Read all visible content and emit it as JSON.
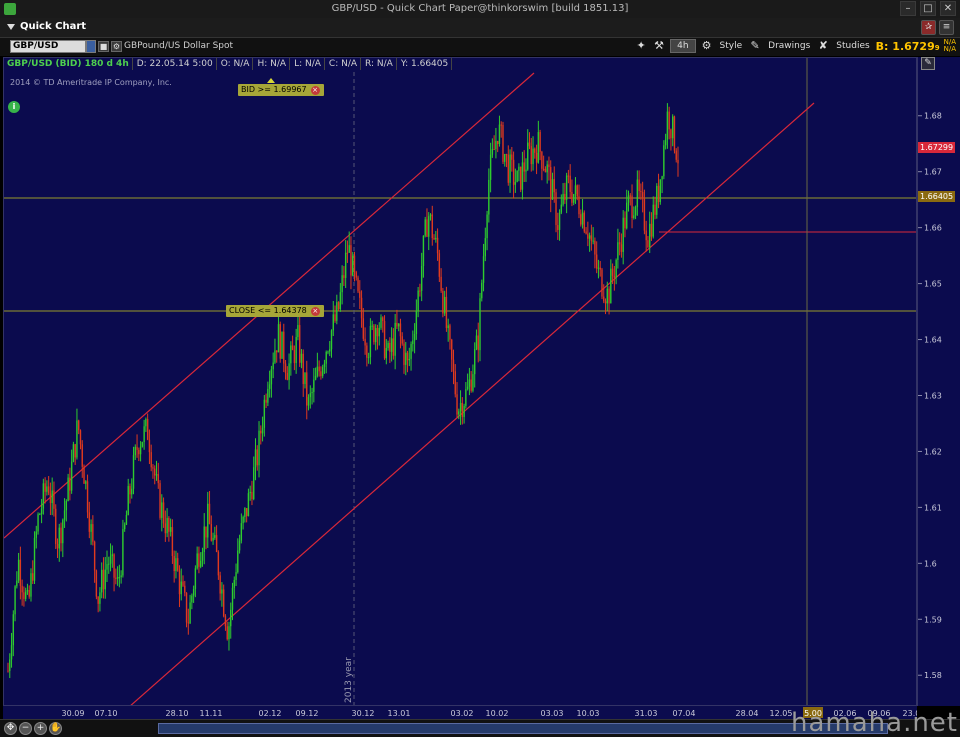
{
  "window": {
    "title": "GBP/USD - Quick Chart Paper@thinkorswim [build 1851.13]"
  },
  "quick_chart": {
    "title": "Quick Chart"
  },
  "toolbar": {
    "symbol": "GBP/USD",
    "symbol_desc": "GBPound/US Dollar Spot",
    "timeframe": "4h",
    "style_label": "Style",
    "drawings_label": "Drawings",
    "studies_label": "Studies",
    "bid_label": "B: 1.6729",
    "bid_suffix": "9",
    "na1": "N/A",
    "na2": "N/A"
  },
  "info": {
    "symbol_line": "GBP/USD (BID) 180 d 4h",
    "date": "D: 22.05.14 5:00",
    "open": "O: N/A",
    "high": "H: N/A",
    "low": "L: N/A",
    "close": "C: N/A",
    "range": "R: N/A",
    "y": "Y: 1.66405",
    "copyright": "2014 © TD Ameritrade IP Company, Inc."
  },
  "alerts": {
    "bid": "BID >= 1.69967",
    "close": "CLOSE <= 1.64378"
  },
  "price_tags": {
    "current": "1.67299",
    "cursor": "1.66405"
  },
  "colors": {
    "background": "#0b0b4e",
    "up": "#2ecc2e",
    "down": "#e03a1e",
    "channel": "#d8283a",
    "hline": "#9a9a2a",
    "current_tag": "#d8283a",
    "cursor_tag": "#8a6a10"
  },
  "chart_data": {
    "type": "candlestick",
    "y_ticks": [
      "1.68",
      "1.67",
      "1.66",
      "1.65",
      "1.64",
      "1.63",
      "1.62",
      "1.61",
      "1.6",
      "1.59",
      "1.58"
    ],
    "x_ticks": [
      "30.09",
      "07.10",
      "28.10",
      "11.11",
      "02.12",
      "09.12",
      "30.12",
      "13.01",
      "03.02",
      "10.02",
      "03.03",
      "10.03",
      "31.03",
      "07.04",
      "28.04",
      "12.05",
      "5.00",
      "02.06",
      "09.06",
      "23.06"
    ],
    "year_label": "2013 year",
    "ylim": [
      1.5745,
      1.6905
    ],
    "close_path": [
      1.581,
      1.601,
      1.592,
      1.608,
      1.615,
      1.604,
      1.613,
      1.625,
      1.611,
      1.594,
      1.601,
      1.596,
      1.611,
      1.622,
      1.624,
      1.612,
      1.606,
      1.598,
      1.59,
      1.602,
      1.608,
      1.6,
      1.588,
      1.603,
      1.611,
      1.62,
      1.634,
      1.641,
      1.635,
      1.64,
      1.628,
      1.634,
      1.64,
      1.645,
      1.657,
      1.647,
      1.639,
      1.644,
      1.637,
      1.642,
      1.635,
      1.648,
      1.663,
      1.655,
      1.64,
      1.628,
      1.631,
      1.64,
      1.668,
      1.678,
      1.671,
      1.668,
      1.673,
      1.675,
      1.67,
      1.661,
      1.668,
      1.665,
      1.66,
      1.652,
      1.648,
      1.656,
      1.664,
      1.666,
      1.659,
      1.666,
      1.681,
      1.673
    ]
  }
}
